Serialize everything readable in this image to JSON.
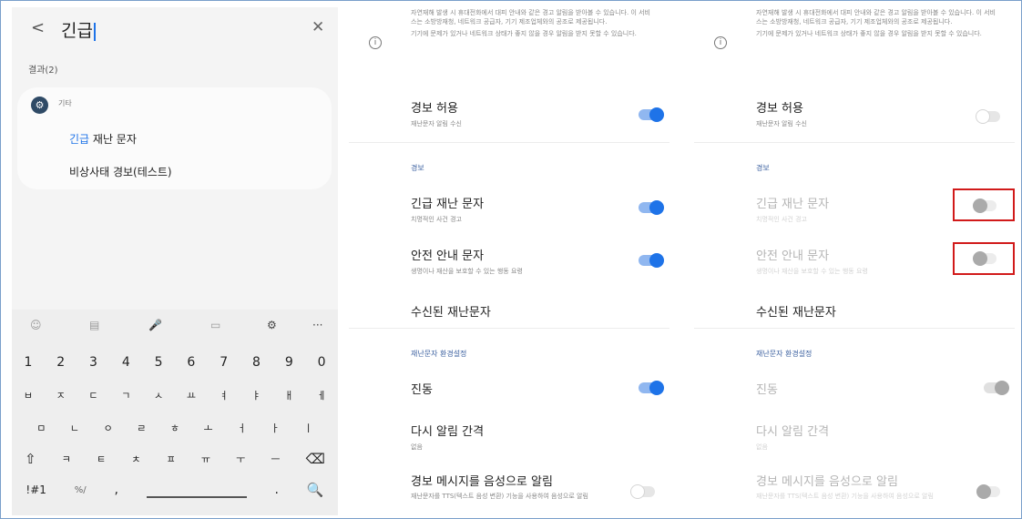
{
  "panel1": {
    "back_glyph": "<",
    "query": "긴급",
    "clear_glyph": "✕",
    "results_label": "결과(2)",
    "category_glyph": "⚙",
    "category_label": "기타",
    "result1_highlight": "긴급",
    "result1_rest": " 재난 문자",
    "result2": "비상사태 경보(테스트)",
    "keyboard": {
      "toolbar": [
        "☺",
        "▤",
        "🎤",
        "▭",
        "⚙",
        "···"
      ],
      "numbers": [
        "1",
        "2",
        "3",
        "4",
        "5",
        "6",
        "7",
        "8",
        "9",
        "0"
      ],
      "row_a": [
        "ㅂ",
        "ㅈ",
        "ㄷ",
        "ㄱ",
        "ㅅ",
        "ㅛ",
        "ㅕ",
        "ㅑ",
        "ㅐ",
        "ㅔ"
      ],
      "row_b": [
        "ㅁ",
        "ㄴ",
        "ㅇ",
        "ㄹ",
        "ㅎ",
        "ㅗ",
        "ㅓ",
        "ㅏ",
        "ㅣ"
      ],
      "row_c": [
        "⇧",
        "ㅋ",
        "ㅌ",
        "ㅊ",
        "ㅍ",
        "ㅠ",
        "ㅜ",
        "ㅡ",
        "⌫"
      ],
      "symbols_key": "!#1",
      "fraction_key": "%/",
      "comma_key": ",",
      "period_key": ".",
      "search_key": "🔍"
    }
  },
  "settings": {
    "info_glyph": "i",
    "info_p1": "자연재해 발생 시 휴대전화에서 대피 안내와 같은 경고 알림을 받아볼 수 있습니다. 이 서비스는 소방방재청, 네트워크 공급자, 기기 제조업체와의 공조로 제공됩니다.",
    "info_p2": "기기에 문제가 있거나 네트워크 상태가 좋지 않을 경우 알림을 받지 못할 수 있습니다.",
    "allow_title": "경보 허용",
    "allow_sub": "재난문자 알림 수신",
    "section_alert": "경보",
    "emergency_title": "긴급 재난 문자",
    "emergency_sub": "치명적인 사건 경고",
    "safety_title": "안전 안내 문자",
    "safety_sub": "생명이나 재산을 보호할 수 있는 행동 요령",
    "received_title": "수신된 재난문자",
    "section_env": "재난문자 환경설정",
    "vibration_title": "진동",
    "reminder_title": "다시 알림 간격",
    "reminder_sub": "없음",
    "voice_title": "경보 메시지를 음성으로 알림",
    "voice_sub": "재난문자를 TTS(텍스트 음성 변환) 기능을 사용하여 음성으로 알림"
  },
  "toggles": {
    "panel2": {
      "allow": "on",
      "emergency": "on",
      "safety": "on",
      "vibration": "on",
      "voice": "off"
    },
    "panel3": {
      "allow": "off",
      "emergency": "off-disabled",
      "safety": "off-disabled",
      "vibration": "on-disabled",
      "voice": "off-disabled"
    }
  },
  "colors": {
    "accent": "#1e73e8",
    "section_header": "#3a5f9f",
    "highlight_box": "#d11a1a"
  }
}
